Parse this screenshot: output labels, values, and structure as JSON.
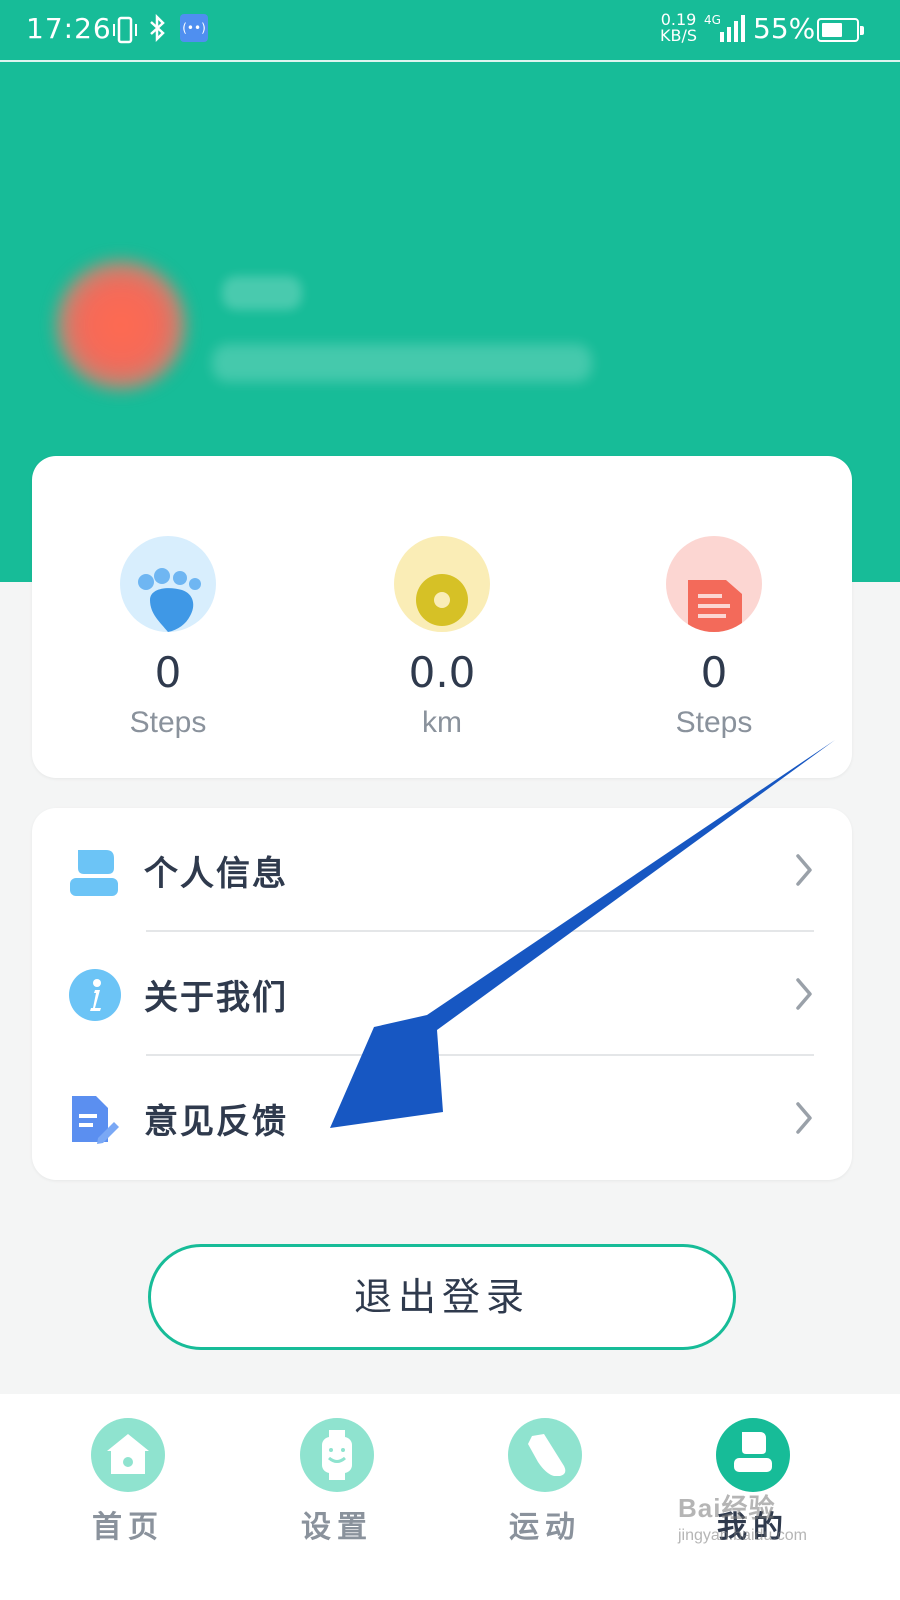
{
  "status_bar": {
    "time": "17:26",
    "speed_value": "0.19",
    "speed_unit": "KB/S",
    "network": "4G",
    "battery": "55%",
    "hotspot_text": "(••)"
  },
  "profile": {
    "name": "",
    "subtitle": ""
  },
  "stats": [
    {
      "value": "0",
      "unit": "Steps",
      "icon": "paw-icon"
    },
    {
      "value": "0.0",
      "unit": "km",
      "icon": "distance-icon"
    },
    {
      "value": "0",
      "unit": "Steps",
      "icon": "document-icon"
    }
  ],
  "menu": [
    {
      "label": "个人信息",
      "icon": "person-icon"
    },
    {
      "label": "关于我们",
      "icon": "info-icon"
    },
    {
      "label": "意见反馈",
      "icon": "feedback-icon"
    }
  ],
  "logout_label": "退出登录",
  "nav": [
    {
      "label": "首页",
      "icon": "home-icon"
    },
    {
      "label": "设置",
      "icon": "watch-icon"
    },
    {
      "label": "运动",
      "icon": "shoe-icon"
    },
    {
      "label": "我的",
      "icon": "profile-icon"
    }
  ],
  "watermark": {
    "brand": "Bai经验",
    "url": "jingyan.baidu.com"
  },
  "colors": {
    "brand_green": "#17bc98",
    "arrow_blue": "#1757c2",
    "text_dark": "#2f3a4d",
    "text_muted": "#8a929c"
  }
}
